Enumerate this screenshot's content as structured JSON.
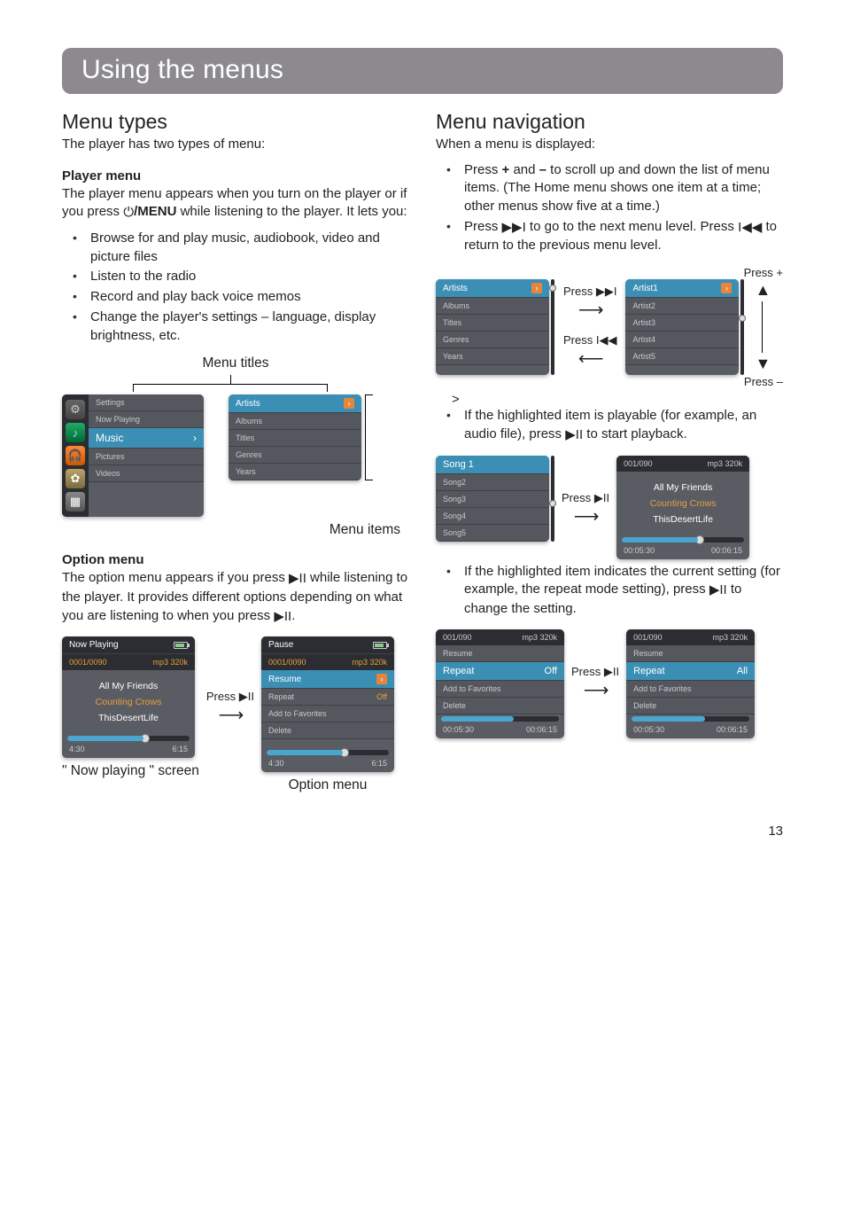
{
  "page_number": "13",
  "title": "Using the menus",
  "left": {
    "h2": "Menu types",
    "intro": "The player has two types of menu:",
    "player_menu_h": "Player menu",
    "player_menu_p1a": "The player menu appears when you turn on the player or if you press ",
    "player_menu_p1b": "/MENU",
    "player_menu_p1c": " while listening to the player. It lets you:",
    "bullets": [
      "Browse for and play music, audiobook, video and picture files",
      "Listen to the radio",
      "Record and play back voice memos",
      "Change the player's settings – language, display brightness, etc."
    ],
    "menu_titles_label": "Menu titles",
    "menu_items_label": "Menu items",
    "home_menu": [
      "Settings",
      "Now Playing",
      "Music",
      "Pictures",
      "Videos"
    ],
    "music_menu": [
      "Artists",
      "Albums",
      "Titles",
      "Genres",
      "Years"
    ],
    "option_menu_h": "Option menu",
    "option_menu_p_a": "The option menu appears if you press ",
    "option_menu_p_b": " while listening to the player. It provides different options depending on what you are listening to when you press ",
    "option_menu_p_c": ".",
    "now_playing_title": "Now Playing",
    "np_header_left": "0001/0090",
    "np_header_right": "mp3 320k",
    "np_lines": [
      "All My Friends",
      "Counting Crows",
      "ThisDesertLife"
    ],
    "np_time_l": "4:30",
    "np_time_r": "6:15",
    "np_caption": "\" Now playing \" screen",
    "press_play": "Press ▶II",
    "opt_title": "Pause",
    "opt_header_left": "0001/0090",
    "opt_header_right": "mp3 320k",
    "opt_rows": [
      {
        "label": "Resume",
        "val": ""
      },
      {
        "label": "Repeat",
        "val": "Off"
      },
      {
        "label": "Add to Favorites",
        "val": ""
      },
      {
        "label": "Delete",
        "val": ""
      }
    ],
    "opt_time_l": "4:30",
    "opt_time_r": "6:15",
    "opt_caption": "Option menu"
  },
  "right": {
    "h2": "Menu navigation",
    "intro": "When a menu is displayed:",
    "b1_a": "Press ",
    "b1_plus": "+",
    "b1_b": " and ",
    "b1_minus": "–",
    "b1_c": " to scroll up and down the list of menu items. (The Home menu shows one item at a time; other menus show five at a time.)",
    "b2_a": "Press ",
    "b2_b": " to go to the next menu level. Press ",
    "b2_c": " to return to the previous menu level.",
    "press_plus": "Press +",
    "press_minus": "Press –",
    "press_next": "Press ▶▶I",
    "press_prev": "Press I◀◀",
    "nav_left_menu": [
      "Artists",
      "Albums",
      "Titles",
      "Genres",
      "Years"
    ],
    "nav_right_menu": [
      "Artist1",
      "Artist2",
      "Artist3",
      "Artist4",
      "Artist5"
    ],
    "b3_a": "If the highlighted item is playable (for example, an audio file), press ",
    "b3_b": " to start playback.",
    "songs_menu": [
      "Song 1",
      "Song2",
      "Song3",
      "Song4",
      "Song5"
    ],
    "press_play": "Press ▶II",
    "play_header_left": "001/090",
    "play_header_right": "mp3 320k",
    "play_lines": [
      "All My Friends",
      "Counting Crows",
      "ThisDesertLife"
    ],
    "play_time_l": "00:05:30",
    "play_time_r": "00:06:15",
    "b4_a": "If the highlighted item indicates the current setting (for example, the repeat mode setting), press ",
    "b4_b": " to change the setting.",
    "set_header_left": "001/090",
    "set_header_right": "mp3 320k",
    "set_rows_l": [
      {
        "label": "Resume",
        "val": ""
      },
      {
        "label": "Repeat",
        "val": "Off"
      },
      {
        "label": "Add to Favorites",
        "val": ""
      },
      {
        "label": "Delete",
        "val": ""
      }
    ],
    "set_rows_r": [
      {
        "label": "Resume",
        "val": ""
      },
      {
        "label": "Repeat",
        "val": "All"
      },
      {
        "label": "Add to Favorites",
        "val": ""
      },
      {
        "label": "Delete",
        "val": ""
      }
    ],
    "set_time_l": "00:05:30",
    "set_time_r": "00:06:15"
  }
}
